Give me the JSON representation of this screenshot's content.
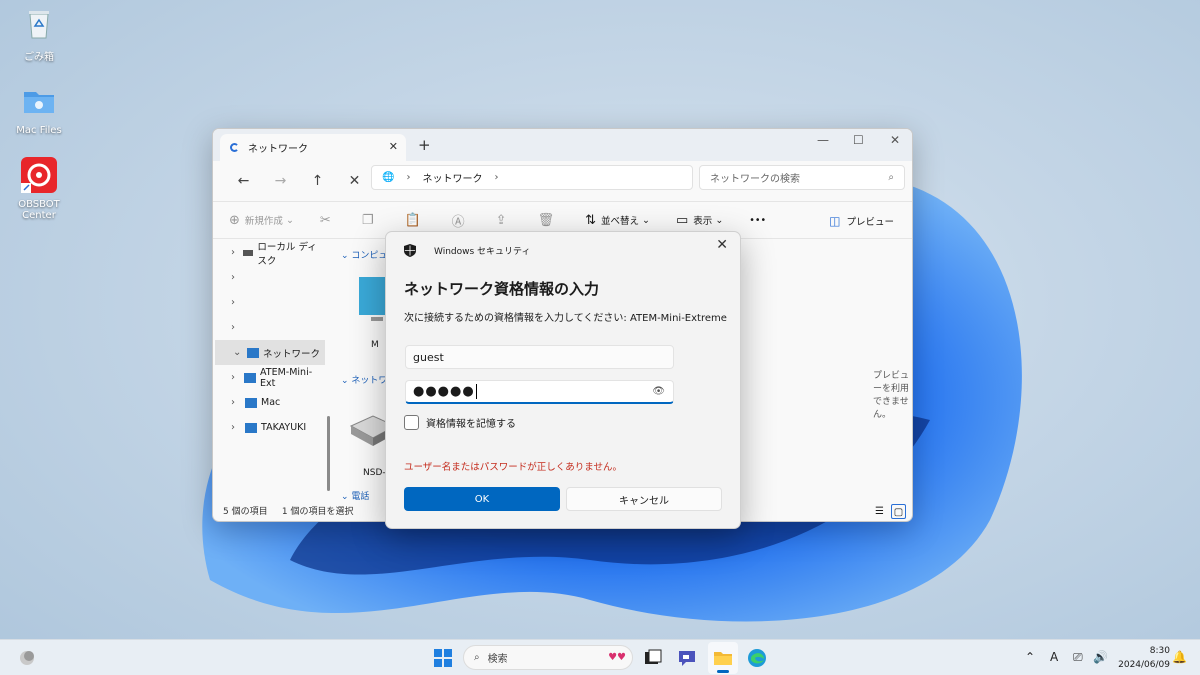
{
  "desktop": {
    "icons": [
      {
        "label": "ごみ箱",
        "icon": "recycle-bin-icon"
      },
      {
        "label": "Mac Files",
        "icon": "folder-icon"
      },
      {
        "label": "OBSBOT Center",
        "icon": "obsbot-app-icon"
      }
    ]
  },
  "explorer": {
    "tab_title": "ネットワーク",
    "address": {
      "segment": "ネットワーク"
    },
    "search_placeholder": "ネットワークの検索",
    "toolbar": {
      "new": "新規作成",
      "sort": "並べ替え",
      "view": "表示",
      "more": "•••",
      "preview": "プレビュー"
    },
    "sidebar": [
      {
        "label": "ローカル ディスク",
        "icon": "drive-icon"
      },
      {
        "label": ""
      },
      {
        "label": ""
      },
      {
        "label": ""
      },
      {
        "label": "ネットワーク",
        "icon": "network-icon",
        "selected": true
      },
      {
        "label": "ATEM-Mini-Ext",
        "icon": "computer-icon"
      },
      {
        "label": "Mac",
        "icon": "computer-icon"
      },
      {
        "label": "TAKAYUKI",
        "icon": "computer-icon"
      }
    ],
    "groups": {
      "computer": "コンピュー",
      "network": "ネットワ",
      "phone": "電話"
    },
    "items": {
      "first": "M",
      "second": "NSD-"
    },
    "preview_unavailable": "プレビューを利用できません。",
    "status": {
      "count": "5 個の項目",
      "selected": "1 個の項目を選択"
    }
  },
  "dialog": {
    "window_title": "Windows セキュリティ",
    "heading": "ネットワーク資格情報の入力",
    "description": "次に接続するための資格情報を入力してください: ATEM-Mini-Extreme",
    "username": "guest",
    "password_mask": "●●●●●",
    "remember_label": "資格情報を記憶する",
    "remember_checked": false,
    "error": "ユーザー名またはパスワードが正しくありません。",
    "ok": "OK",
    "cancel": "キャンセル"
  },
  "taskbar": {
    "search": "検索",
    "tray": {
      "ime": "A"
    },
    "time": "8:30",
    "date": "2024/06/09"
  },
  "colors": {
    "accent": "#0067c0",
    "error": "#c42b1c"
  }
}
